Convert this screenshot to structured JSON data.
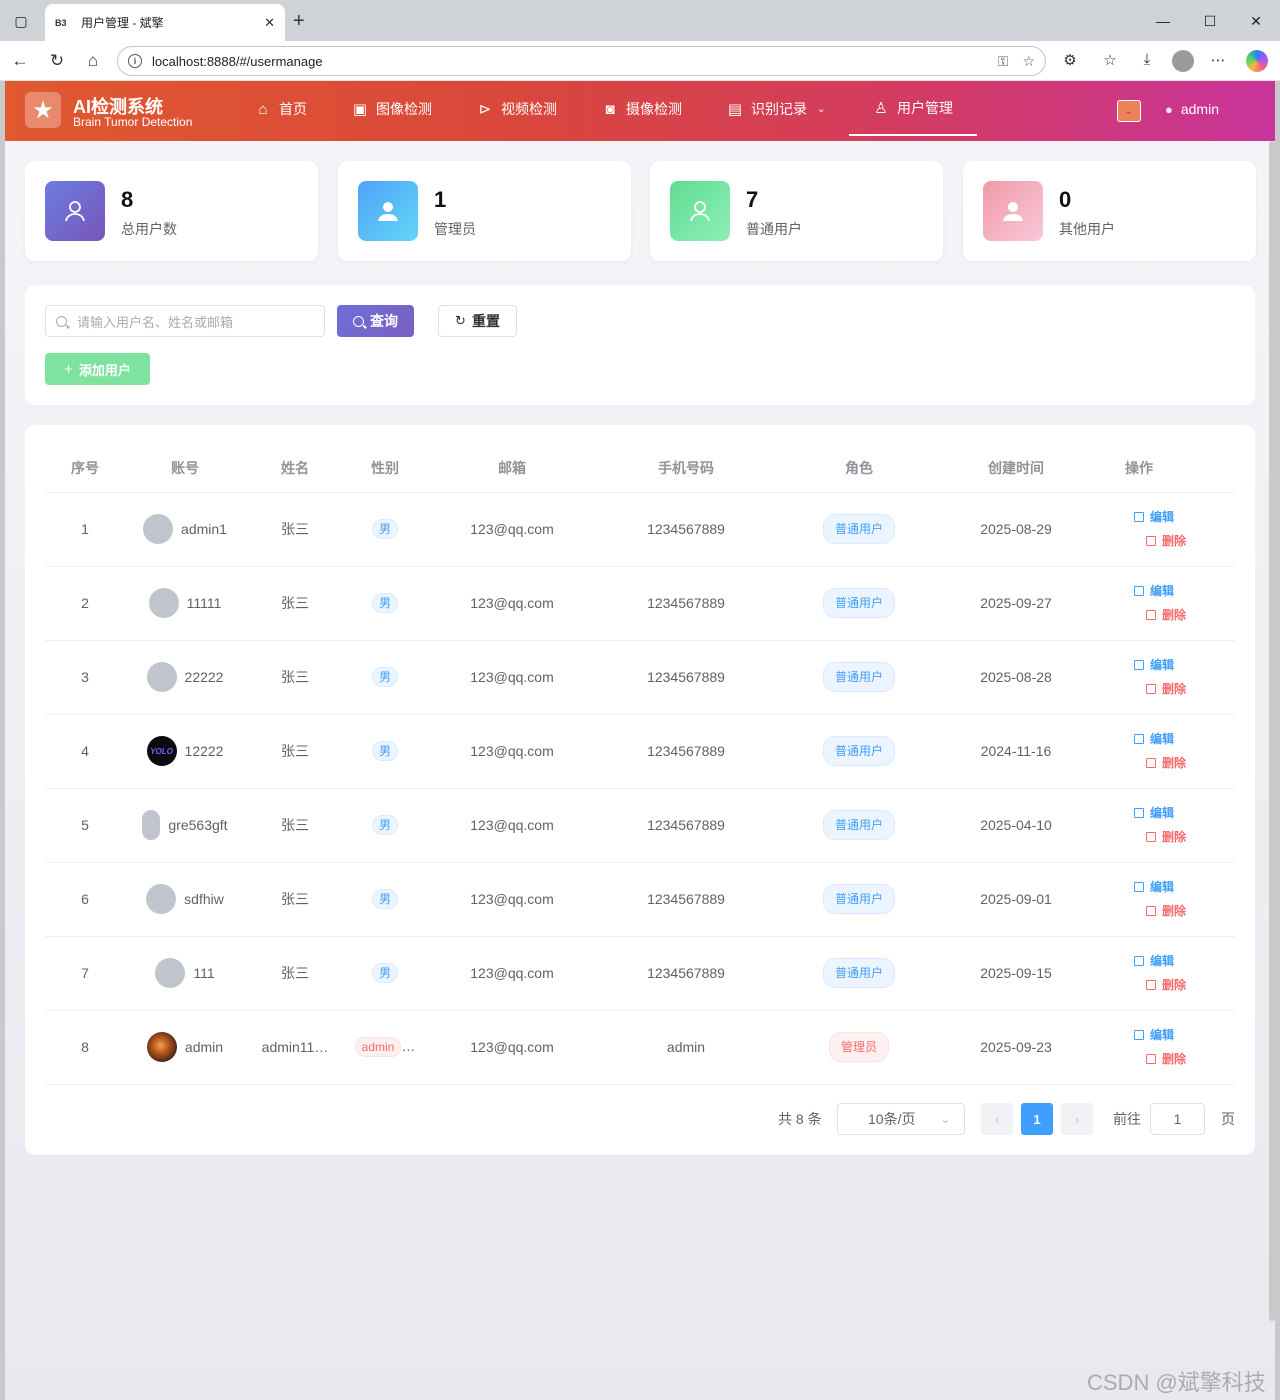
{
  "browser": {
    "tab_title": "用户管理 - 斌擎",
    "tab_favicon": "B3",
    "url": "localhost:8888/#/usermanage"
  },
  "header": {
    "brand_title": "AI检测系统",
    "brand_sub": "Brain Tumor Detection",
    "menu": [
      {
        "label": "首页",
        "icon": "home-icon"
      },
      {
        "label": "图像检测",
        "icon": "image-icon"
      },
      {
        "label": "视频检测",
        "icon": "play-circle-icon"
      },
      {
        "label": "摄像检测",
        "icon": "camera-icon"
      },
      {
        "label": "识别记录",
        "icon": "document-icon"
      },
      {
        "label": "用户管理",
        "icon": "user-icon"
      }
    ],
    "username": "admin"
  },
  "stats": [
    {
      "value": "8",
      "label": "总用户数",
      "color": "#7a67cf"
    },
    {
      "value": "1",
      "label": "管理员",
      "color": "#54b5f7"
    },
    {
      "value": "7",
      "label": "普通用户",
      "color": "#6edd9a"
    },
    {
      "value": "0",
      "label": "其他用户",
      "color": "#f2a3b3"
    }
  ],
  "toolbar": {
    "search_placeholder": "请输入用户名、姓名或邮箱",
    "query_label": "查询",
    "reset_label": "重置",
    "add_label": "添加用户"
  },
  "table": {
    "columns": [
      "序号",
      "账号",
      "姓名",
      "性别",
      "邮箱",
      "手机号码",
      "角色",
      "创建时间",
      "操作"
    ],
    "rows": [
      {
        "idx": "1",
        "account": "admin1",
        "name": "张三",
        "gender": "男",
        "email": "123@qq.com",
        "phone": "1234567889",
        "role": "普通用户",
        "created": "2025-08-29"
      },
      {
        "idx": "2",
        "account": "11111",
        "name": "张三",
        "gender": "男",
        "email": "123@qq.com",
        "phone": "1234567889",
        "role": "普通用户",
        "created": "2025-09-27"
      },
      {
        "idx": "3",
        "account": "22222",
        "name": "张三",
        "gender": "男",
        "email": "123@qq.com",
        "phone": "1234567889",
        "role": "普通用户",
        "created": "2025-08-28"
      },
      {
        "idx": "4",
        "account": "12222",
        "name": "张三",
        "gender": "男",
        "email": "123@qq.com",
        "phone": "1234567889",
        "role": "普通用户",
        "created": "2024-11-16"
      },
      {
        "idx": "5",
        "account": "gre563gft",
        "name": "张三",
        "gender": "男",
        "email": "123@qq.com",
        "phone": "1234567889",
        "role": "普通用户",
        "created": "2025-04-10"
      },
      {
        "idx": "6",
        "account": "sdfhiw",
        "name": "张三",
        "gender": "男",
        "email": "123@qq.com",
        "phone": "1234567889",
        "role": "普通用户",
        "created": "2025-09-01"
      },
      {
        "idx": "7",
        "account": "111",
        "name": "张三",
        "gender": "男",
        "email": "123@qq.com",
        "phone": "1234567889",
        "role": "普通用户",
        "created": "2025-09-15"
      },
      {
        "idx": "8",
        "account": "admin",
        "name": "admin11…",
        "gender": "admin",
        "gender_more": "…",
        "email": "123@qq.com",
        "phone": "admin",
        "role": "管理员",
        "created": "2025-09-23"
      }
    ],
    "edit_label": "编辑",
    "delete_label": "删除",
    "avatar_yolo_text": "YOLO"
  },
  "pagination": {
    "total": "共 8 条",
    "page_size": "10条/页",
    "current": "1",
    "goto_label": "前往",
    "goto_value": "1",
    "page_suffix": "页"
  },
  "watermark": "CSDN @斌擎科技",
  "colors": {
    "accent": "#409eff",
    "danger": "#f56c6c"
  }
}
